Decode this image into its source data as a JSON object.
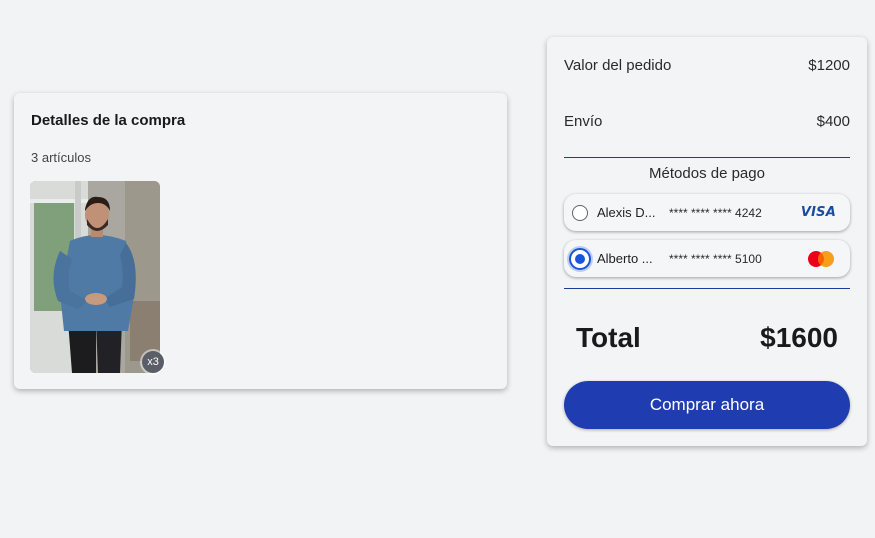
{
  "details": {
    "title": "Detalles de la compra",
    "item_count": "3 artículos",
    "products": [
      {
        "image": "man-in-denim-shirt-photo",
        "quantity_badge": "x3"
      }
    ]
  },
  "summary": {
    "order_value_label": "Valor del pedido",
    "order_value": "$1200",
    "shipping_label": "Envío",
    "shipping_value": "$400",
    "payment_methods_title": "Métodos de pago",
    "payment_methods": [
      {
        "holder": "Alexis D...",
        "number": "**** **** **** 4242",
        "brand": "VISA",
        "selected": false
      },
      {
        "holder": "Alberto ...",
        "number": "**** **** **** 5100",
        "brand": "mastercard-icon",
        "selected": true
      }
    ],
    "total_label": "Total",
    "total_value": "$1600",
    "buy_button_label": "Comprar ahora"
  },
  "colors": {
    "background": "#f2f3f5",
    "accent": "#1f3db0",
    "radio_selected": "#1a56db",
    "visa": "#1a4da0"
  }
}
